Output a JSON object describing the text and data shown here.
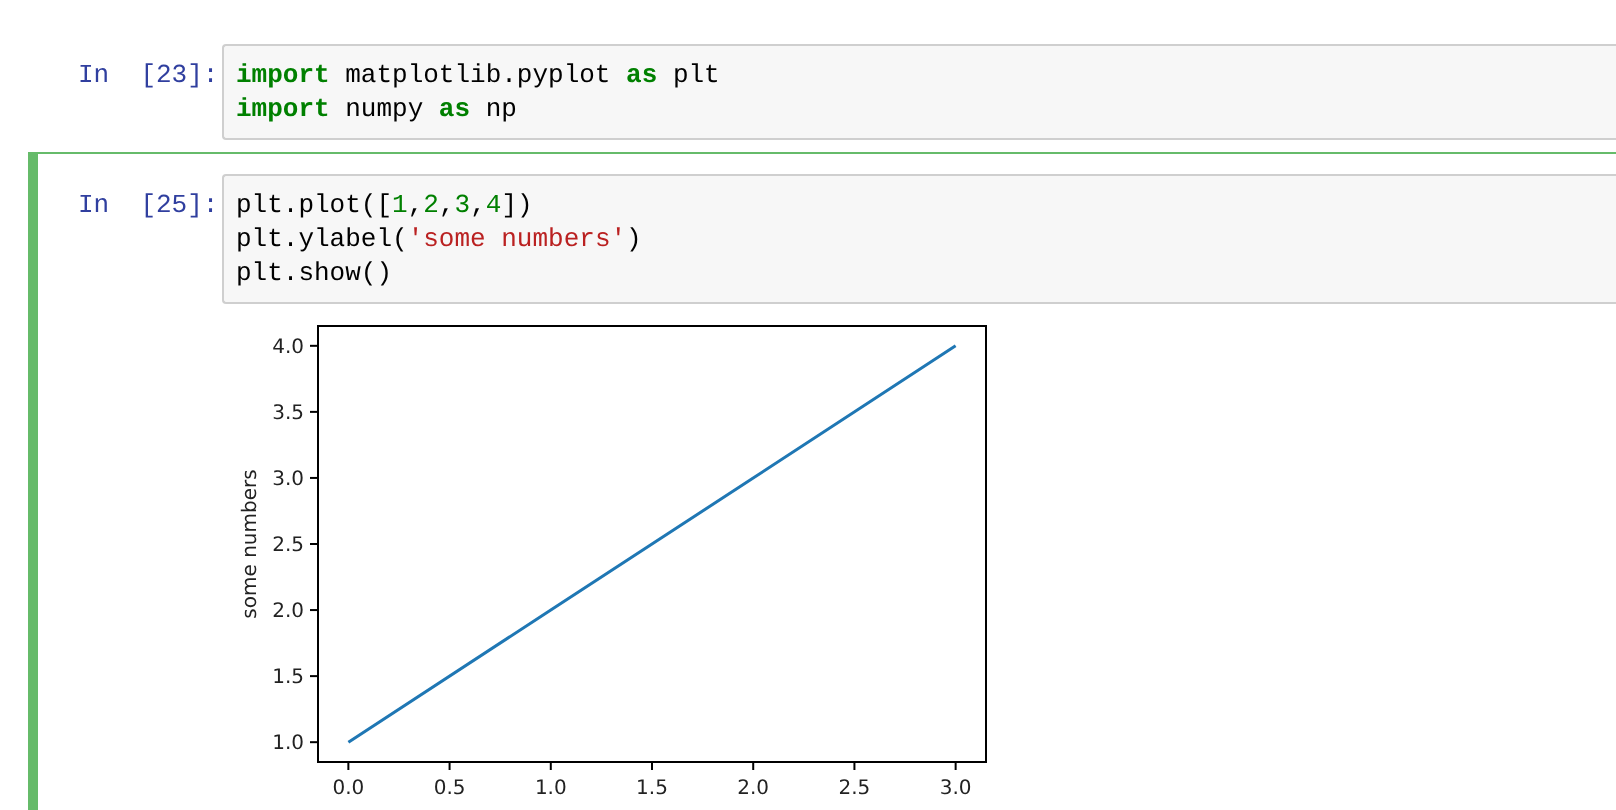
{
  "cells": [
    {
      "prompt": "In  [23]:",
      "selected": false,
      "code": [
        [
          {
            "kind": "keyword",
            "text": "import"
          },
          {
            "kind": "plain",
            "text": " matplotlib.pyplot "
          },
          {
            "kind": "keyword",
            "text": "as"
          },
          {
            "kind": "plain",
            "text": " plt"
          }
        ],
        [
          {
            "kind": "keyword",
            "text": "import"
          },
          {
            "kind": "plain",
            "text": " numpy "
          },
          {
            "kind": "keyword",
            "text": "as"
          },
          {
            "kind": "plain",
            "text": " np"
          }
        ]
      ]
    },
    {
      "prompt": "In  [25]:",
      "selected": true,
      "code": [
        [
          {
            "kind": "plain",
            "text": "plt.plot(["
          },
          {
            "kind": "number",
            "text": "1"
          },
          {
            "kind": "plain",
            "text": ","
          },
          {
            "kind": "number",
            "text": "2"
          },
          {
            "kind": "plain",
            "text": ","
          },
          {
            "kind": "number",
            "text": "3"
          },
          {
            "kind": "plain",
            "text": ","
          },
          {
            "kind": "number",
            "text": "4"
          },
          {
            "kind": "plain",
            "text": "])"
          }
        ],
        [
          {
            "kind": "plain",
            "text": "plt.ylabel("
          },
          {
            "kind": "string",
            "text": "'some numbers'"
          },
          {
            "kind": "plain",
            "text": ")"
          }
        ],
        [
          {
            "kind": "plain",
            "text": "plt.show()"
          }
        ]
      ],
      "output": {
        "chart_data": {
          "type": "line",
          "ylabel": "some numbers",
          "x": [
            0,
            1,
            2,
            3
          ],
          "series": [
            {
              "color": "#1f77b4",
              "values": [
                1,
                2,
                3,
                4
              ]
            }
          ],
          "xlim": [
            -0.15,
            3.15
          ],
          "ylim": [
            0.85,
            4.15
          ],
          "xticks": [
            {
              "value": 0,
              "label": "0.0"
            },
            {
              "value": 0.5,
              "label": "0.5"
            },
            {
              "value": 1,
              "label": "1.0"
            },
            {
              "value": 1.5,
              "label": "1.5"
            },
            {
              "value": 2,
              "label": "2.0"
            },
            {
              "value": 2.5,
              "label": "2.5"
            },
            {
              "value": 3,
              "label": "3.0"
            }
          ],
          "yticks": [
            {
              "value": 1,
              "label": "1.0"
            },
            {
              "value": 1.5,
              "label": "1.5"
            },
            {
              "value": 2,
              "label": "2.0"
            },
            {
              "value": 2.5,
              "label": "2.5"
            },
            {
              "value": 3,
              "label": "3.0"
            },
            {
              "value": 3.5,
              "label": "3.5"
            },
            {
              "value": 4,
              "label": "4.0"
            }
          ]
        }
      }
    }
  ]
}
